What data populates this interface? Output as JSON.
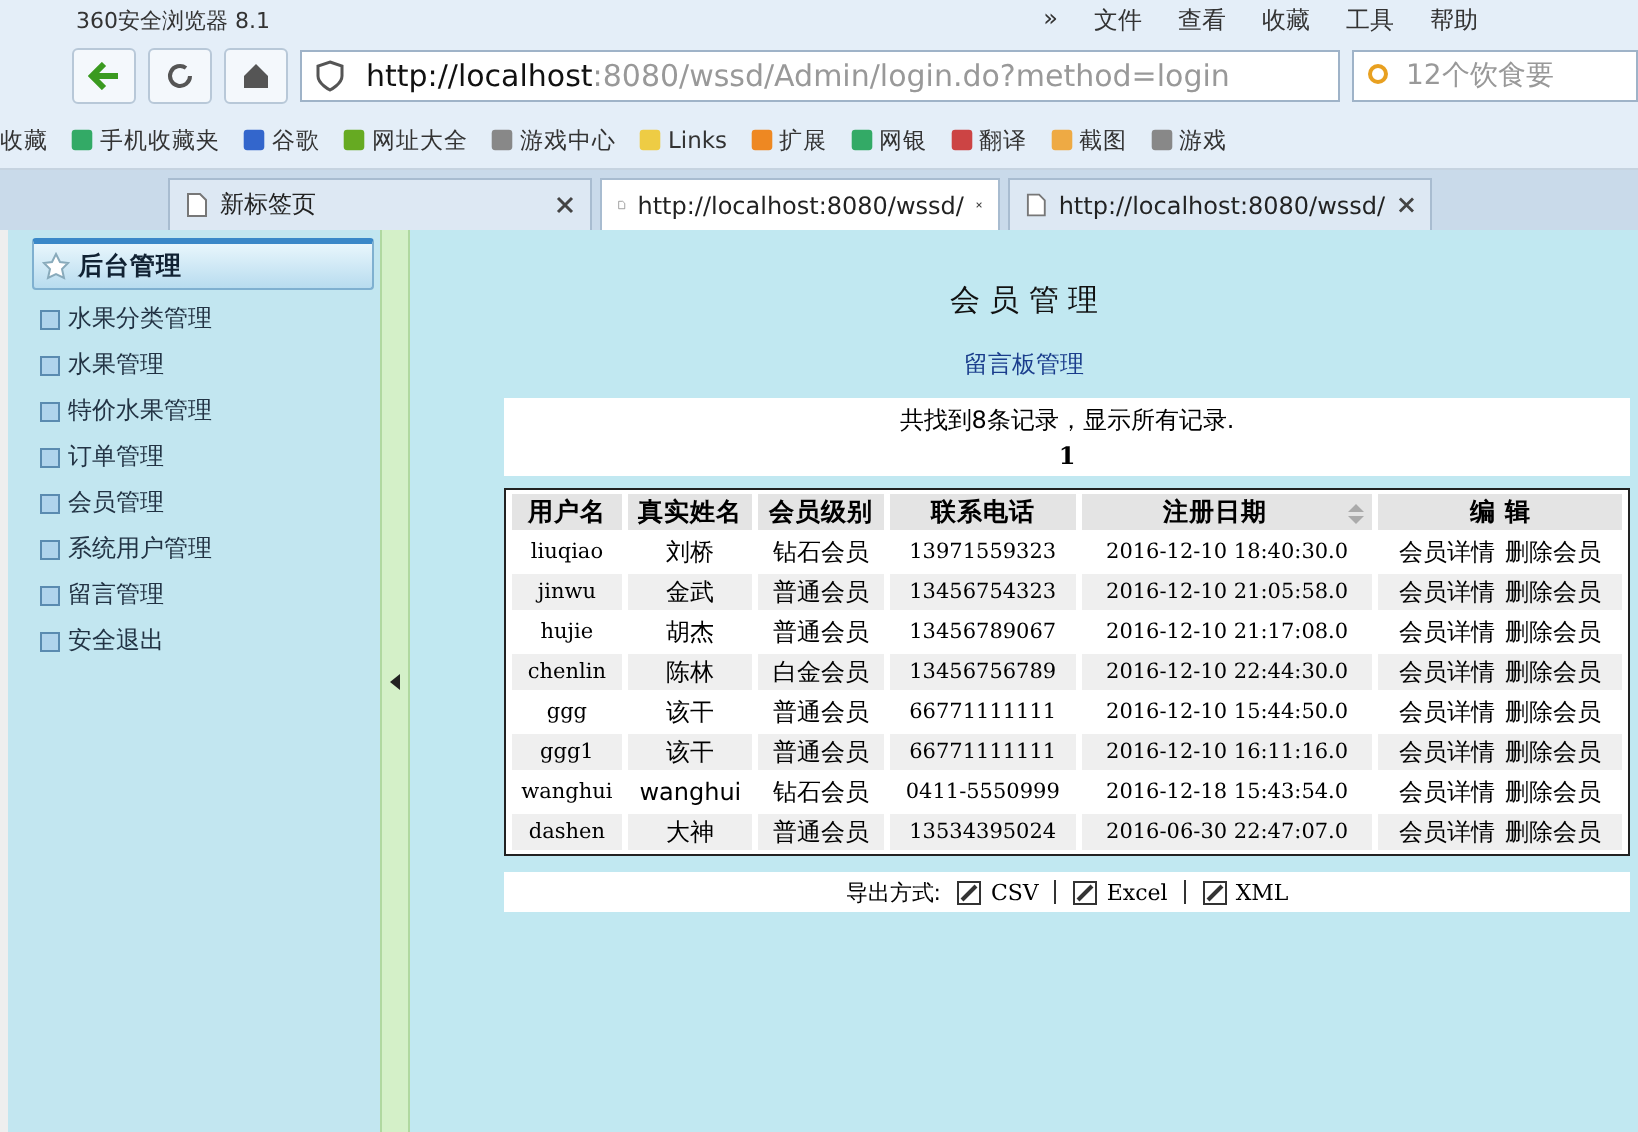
{
  "window": {
    "title": "360安全浏览器 8.1",
    "menu": [
      "»",
      "文件",
      "查看",
      "收藏",
      "工具",
      "帮助"
    ]
  },
  "address_bar": {
    "url_host": "http://localhost",
    "url_rest": ":8080/wssd/Admin/login.do?method=login",
    "search_placeholder": "12个饮食要"
  },
  "bookmarks": [
    "收藏",
    "手机收藏夹",
    "谷歌",
    "网址大全",
    "游戏中心",
    "Links",
    "扩展",
    "网银",
    "翻译",
    "截图",
    "游戏"
  ],
  "tabs": [
    {
      "label": "新标签页",
      "selected": false
    },
    {
      "label": "http://localhost:8080/wssd/",
      "selected": true
    },
    {
      "label": "http://localhost:8080/wssd/",
      "selected": false
    }
  ],
  "sidebar": {
    "header": "后台管理",
    "items": [
      "水果分类管理",
      "水果管理",
      "特价水果管理",
      "订单管理",
      "会员管理",
      "系统用户管理",
      "留言管理",
      "安全退出"
    ]
  },
  "page": {
    "title": "会 员 管 理",
    "link": "留言板管理",
    "summary": "共找到8条记录，显示所有记录.",
    "page_number": "1"
  },
  "table": {
    "columns": [
      "用户名",
      "真实姓名",
      "会员级别",
      "联系电话",
      "注册日期",
      "编  辑"
    ],
    "rows": [
      {
        "cells": [
          "liuqiao",
          "刘桥",
          "钻石会员",
          "13971559323",
          "2016-12-10 18:40:30.0"
        ],
        "actions": [
          "会员详情",
          "删除会员"
        ]
      },
      {
        "cells": [
          "jinwu",
          "金武",
          "普通会员",
          "13456754323",
          "2016-12-10 21:05:58.0"
        ],
        "actions": [
          "会员详情",
          "删除会员"
        ]
      },
      {
        "cells": [
          "hujie",
          "胡杰",
          "普通会员",
          "13456789067",
          "2016-12-10 21:17:08.0"
        ],
        "actions": [
          "会员详情",
          "删除会员"
        ]
      },
      {
        "cells": [
          "chenlin",
          "陈林",
          "白金会员",
          "13456756789",
          "2016-12-10 22:44:30.0"
        ],
        "actions": [
          "会员详情",
          "删除会员"
        ]
      },
      {
        "cells": [
          "ggg",
          "该干",
          "普通会员",
          "66771111111",
          "2016-12-10 15:44:50.0"
        ],
        "actions": [
          "会员详情",
          "删除会员"
        ]
      },
      {
        "cells": [
          "ggg1",
          "该干",
          "普通会员",
          "66771111111",
          "2016-12-10 16:11:16.0"
        ],
        "actions": [
          "会员详情",
          "删除会员"
        ]
      },
      {
        "cells": [
          "wanghui",
          "wanghui",
          "钻石会员",
          "0411-5550999",
          "2016-12-18 15:43:54.0"
        ],
        "actions": [
          "会员详情",
          "删除会员"
        ]
      },
      {
        "cells": [
          "dashen",
          "大神",
          "普通会员",
          "13534395024",
          "2016-06-30 22:47:07.0"
        ],
        "actions": [
          "会员详情",
          "删除会员"
        ]
      }
    ]
  },
  "export": {
    "label": "导出方式:",
    "formats": [
      "CSV",
      "Excel",
      "XML"
    ]
  }
}
